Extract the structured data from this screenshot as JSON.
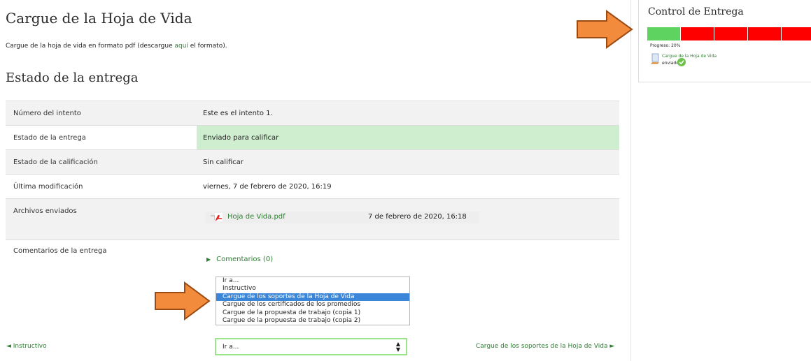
{
  "page": {
    "title": "Cargue de la Hoja de Vida",
    "intro": {
      "before": "Cargue de la hoja de vida en formato pdf (descargue ",
      "link": "aquí",
      "after": " el formato)."
    },
    "status_heading": "Estado de la entrega"
  },
  "status_table": {
    "attempt": {
      "label": "Número del intento",
      "value": "Este es el intento 1."
    },
    "submission": {
      "label": "Estado de la entrega",
      "value": "Enviado para calificar"
    },
    "grading": {
      "label": "Estado de la calificación",
      "value": "Sin calificar"
    },
    "modified": {
      "label": "Última modificación",
      "value": "viernes, 7 de febrero de 2020, 16:19"
    },
    "files": {
      "label": "Archivos enviados",
      "file_name": "Hoja de Vida.pdf",
      "file_date": "7 de febrero de 2020, 16:18"
    },
    "comments": {
      "label": "Comentarios de la entrega",
      "link": "Comentarios (0)"
    }
  },
  "jump_menu": {
    "options": [
      "Ir a...",
      "Instructivo",
      "Cargue de los soportes de la Hoja de Vida",
      "Cargue de los certificados de los promedios",
      "Cargue de la propuesta de trabajo (copia 1)",
      "Cargue de la propuesta de trabajo (copia 2)"
    ],
    "highlighted_index": 2,
    "selected": "Ir a..."
  },
  "nav": {
    "prev": "◄ Instructivo",
    "next": "Cargue de los soportes de la Hoja de Vida ►"
  },
  "sidebar": {
    "block_title": "Control de Entrega",
    "progress_text": "Progreso: 20%",
    "progress_fraction": 0.2,
    "segments": [
      "complete",
      "incomplete",
      "incomplete",
      "incomplete",
      "incomplete"
    ],
    "activity_name": "Cargue de la Hoja de Vida",
    "activity_status": "enviado"
  },
  "colors": {
    "link": "#2e7d32",
    "progress_complete": "#5fd35f",
    "progress_incomplete": "#ff0000",
    "submitted_row": "#cfeecf",
    "highlight_option": "#3b86d8",
    "annotation_arrow": "#f28b3c"
  },
  "icons": [
    "pdf-icon",
    "document-icon",
    "check-icon",
    "annotation-arrow",
    "updown-icon"
  ]
}
